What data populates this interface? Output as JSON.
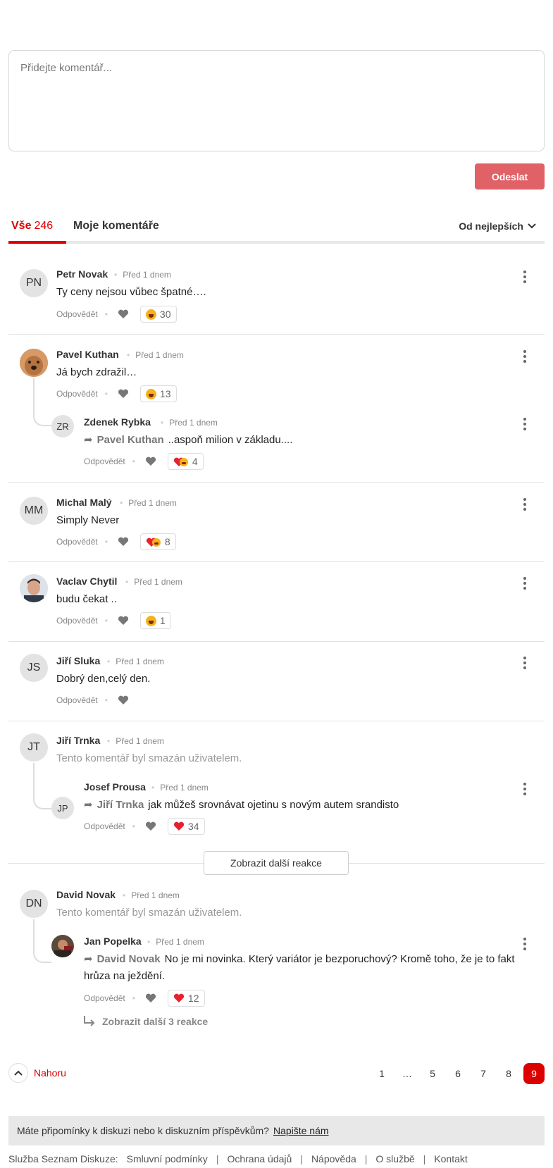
{
  "compose": {
    "placeholder": "Přidejte komentář...",
    "send_label": "Odeslat"
  },
  "tabs": {
    "all_label": "Vše",
    "all_count": "246",
    "mine_label": "Moje komentáře",
    "sort_label": "Od nejlepších"
  },
  "actions": {
    "reply_label": "Odpovědět"
  },
  "comments": [
    {
      "author": "Petr Novak",
      "initials": "PN",
      "time": "Před 1 dnem",
      "text": "Ty ceny nejsou vůbec špatné….",
      "reaction_count": "30"
    },
    {
      "author": "Pavel Kuthan",
      "time": "Před 1 dnem",
      "text": "Já bych zdražil…",
      "reaction_count": "13",
      "reply": {
        "author": "Zdenek Rybka",
        "initials": "ZR",
        "time": "Před 1 dnem",
        "reply_to": "Pavel Kuthan",
        "text": "..aspoň milion v základu....",
        "reaction_count": "4"
      }
    },
    {
      "author": "Michal Malý",
      "initials": "MM",
      "time": "Před 1 dnem",
      "text": "Simply Never",
      "reaction_count": "8"
    },
    {
      "author": "Vaclav Chytil",
      "time": "Před 1 dnem",
      "text": "budu čekat ..",
      "reaction_count": "1"
    },
    {
      "author": "Jiří Sluka",
      "initials": "JS",
      "time": "Před 1 dnem",
      "text": "Dobrý den,celý den."
    },
    {
      "author": "Jiří Trnka",
      "initials": "JT",
      "time": "Před 1 dnem",
      "text": "Tento komentář byl smazán uživatelem.",
      "reply": {
        "author": "Josef Prousa",
        "initials": "JP",
        "time": "Před 1 dnem",
        "reply_to": "Jiří Trnka",
        "text": "jak můžeš srovnávat ojetinu s novým autem srandisto",
        "reaction_count": "34"
      }
    },
    {
      "author": "David Novak",
      "initials": "DN",
      "time": "Před 1 dnem",
      "text": "Tento komentář byl smazán uživatelem.",
      "reply": {
        "author": "Jan Popelka",
        "time": "Před 1 dnem",
        "reply_to": "David Novak",
        "text": "No je mi novinka. Který variátor je bezporuchový? Kromě toho, že je to fakt hrůza na ježdění.",
        "reaction_count": "12"
      }
    }
  ],
  "more_reactions_label": "Zobrazit další reakce",
  "more_replies_label": "Zobrazit další 3 reakce",
  "nav": {
    "up_label": "Nahoru"
  },
  "pagination": {
    "pages": [
      "1",
      "…",
      "5",
      "6",
      "7",
      "8",
      "9"
    ],
    "current": "9"
  },
  "feedback": {
    "text": "Máte připomínky k diskuzi nebo k diskuzním příspěvkům?",
    "link": "Napište nám"
  },
  "footer": {
    "service": "Služba Seznam Diskuze:",
    "links": [
      "Smluvní podmínky",
      "Ochrana údajů",
      "Nápověda",
      "O službě",
      "Kontakt"
    ]
  },
  "colors": {
    "accent": "#dd0000",
    "send_button": "#e06166",
    "heart": "#e8202e"
  },
  "icons": [
    "heart-icon",
    "laugh-emoji-icon",
    "heart-laugh-emoji-icon",
    "reply-arrow-icon",
    "kebab-menu-icon",
    "chevron-down-icon",
    "chevron-up-icon"
  ]
}
